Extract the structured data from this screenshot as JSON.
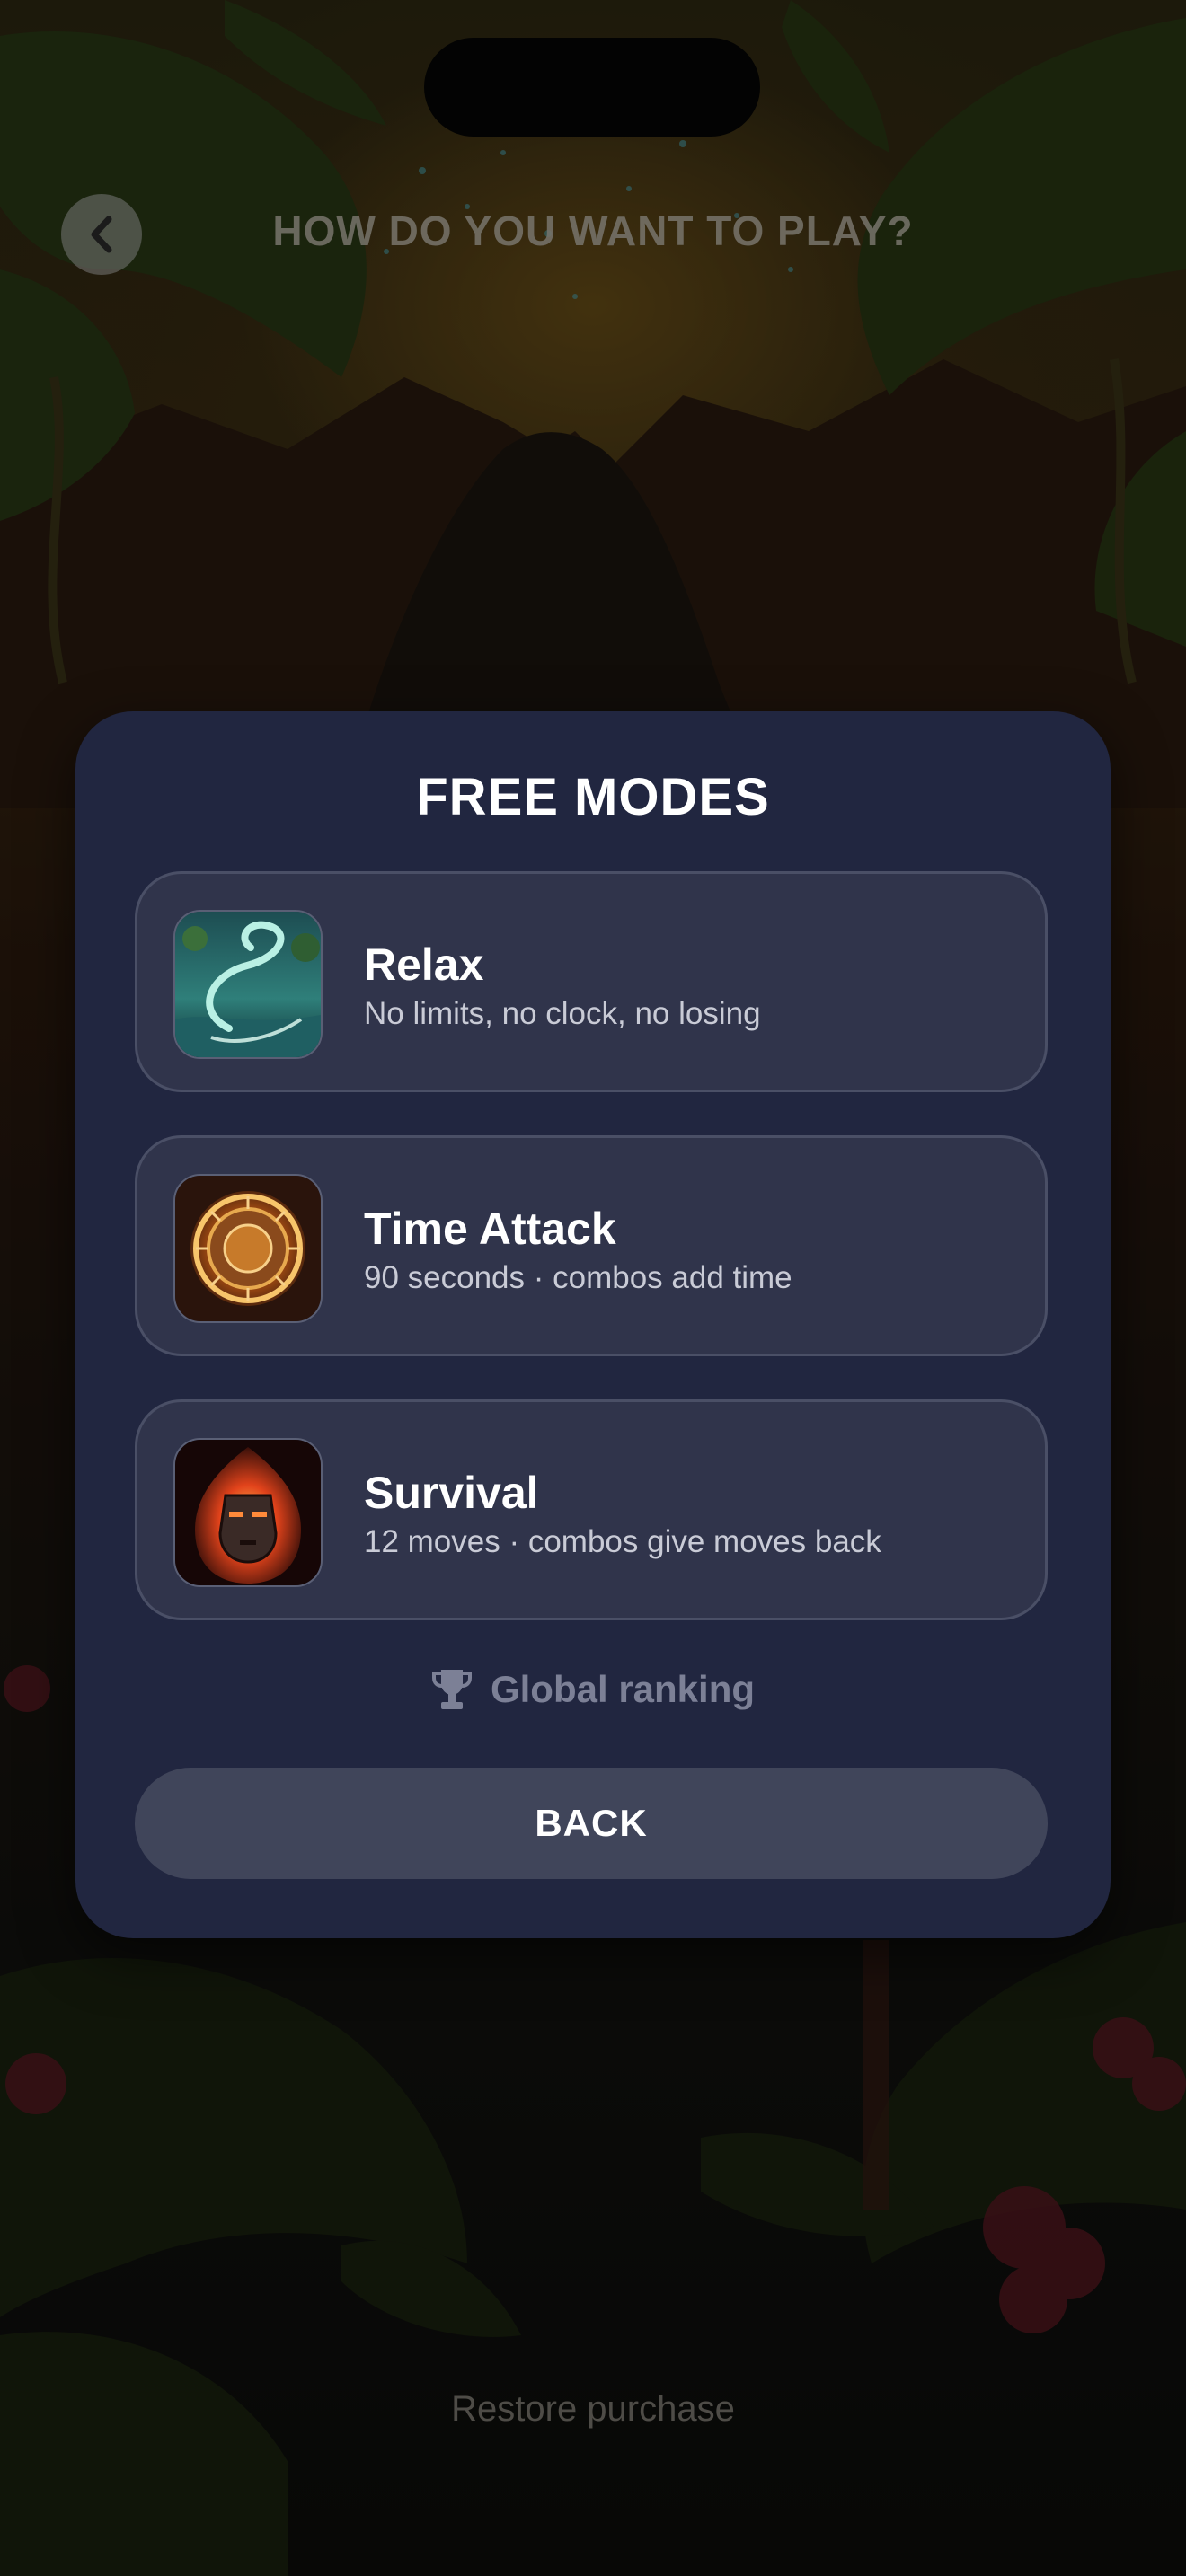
{
  "screen": {
    "title": "HOW DO YOU WANT TO PLAY?",
    "restore_label": "Restore purchase"
  },
  "icons": {
    "back": "chevron-left-icon",
    "ranking": "trophy-icon"
  },
  "modal": {
    "title": "FREE MODES",
    "modes": [
      {
        "name": "Relax",
        "description": "No limits, no clock, no losing",
        "image": "swirling-water-image"
      },
      {
        "name": "Time Attack",
        "description": "90 seconds · combos add time",
        "image": "aztec-sun-disc-image"
      },
      {
        "name": "Survival",
        "description": "12 moves · combos give moves back",
        "image": "fiery-mask-image"
      }
    ],
    "ranking_label": "Global ranking",
    "back_label": "BACK"
  },
  "colors": {
    "modal_bg": "#212640",
    "card_bg": "#30344b",
    "button_bg": "#40455a",
    "muted_text": "#7c8096"
  }
}
